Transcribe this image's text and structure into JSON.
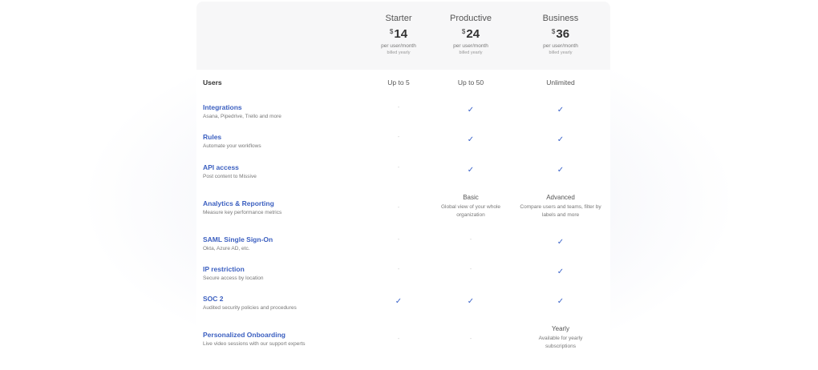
{
  "plans": [
    {
      "name": "Starter",
      "currency": "$",
      "price": "14",
      "per": "per user/month",
      "billed": "billed yearly"
    },
    {
      "name": "Productive",
      "currency": "$",
      "price": "24",
      "per": "per user/month",
      "billed": "billed yearly"
    },
    {
      "name": "Business",
      "currency": "$",
      "price": "36",
      "per": "per user/month",
      "billed": "billed yearly"
    }
  ],
  "users": {
    "label": "Users",
    "values": [
      "Up to 5",
      "Up to 50",
      "Unlimited"
    ]
  },
  "features": [
    {
      "title": "Integrations",
      "desc": "Asana, Pipedrive, Trello and more",
      "cells": [
        "-",
        "✓",
        "✓"
      ]
    },
    {
      "title": "Rules",
      "desc": "Automate your workflows",
      "cells": [
        "-",
        "✓",
        "✓"
      ]
    },
    {
      "title": "API access",
      "desc": "Post content to Missive",
      "cells": [
        "-",
        "✓",
        "✓"
      ]
    },
    {
      "title": "Analytics & Reporting",
      "desc": "Measure key performance metrics",
      "cells": [
        "-",
        "Basic",
        "Advanced"
      ],
      "subs": [
        "",
        "Global view of your whole organization",
        "Compare users and teams, filter by labels and more"
      ]
    },
    {
      "title": "SAML Single Sign-On",
      "desc": "Okta, Azure AD, etc.",
      "cells": [
        "-",
        "-",
        "✓"
      ]
    },
    {
      "title": "IP restriction",
      "desc": "Secure access by location",
      "cells": [
        "-",
        "-",
        "✓"
      ]
    },
    {
      "title": "SOC 2",
      "desc": "Audited security policies and procedures",
      "cells": [
        "✓",
        "✓",
        "✓"
      ]
    },
    {
      "title": "Personalized Onboarding",
      "desc": "Live video sessions with our support experts",
      "cells": [
        "-",
        "-",
        "Yearly"
      ],
      "subs": [
        "",
        "",
        "Available for yearly subscriptions"
      ]
    }
  ],
  "colors": {
    "accent": "#3b5fc0",
    "header_bg": "#f7f7f8",
    "check": "#3b63c9"
  }
}
